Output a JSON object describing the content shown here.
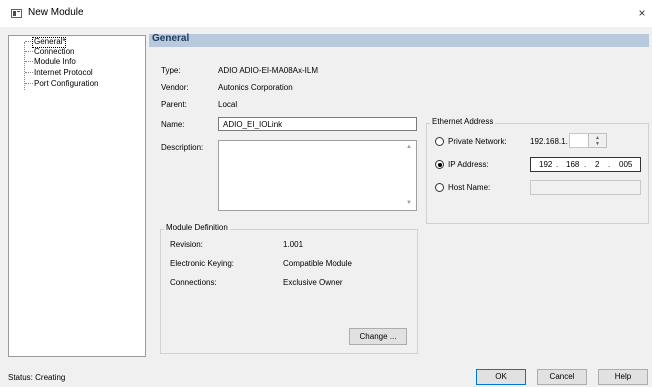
{
  "window": {
    "title": "New Module",
    "close_glyph": "×"
  },
  "tree": {
    "items": [
      {
        "label": "General*"
      },
      {
        "label": "Connection"
      },
      {
        "label": "Module Info"
      },
      {
        "label": "Internet Protocol"
      },
      {
        "label": "Port Configuration"
      }
    ]
  },
  "general": {
    "header": "General",
    "type_label": "Type:",
    "type_value": "ADIO ADIO-EI-MA08Ax-ILM",
    "vendor_label": "Vendor:",
    "vendor_value": "Autonics Corporation",
    "parent_label": "Parent:",
    "parent_value": "Local",
    "name_label": "Name:",
    "name_value": "ADIO_EI_IOLink",
    "description_label": "Description:",
    "description_value": ""
  },
  "ethernet": {
    "group_title": "Ethernet Address",
    "private_label": "Private Network:",
    "private_prefix": "192.168.1.",
    "private_value": "",
    "ip_label": "IP Address:",
    "ip_octets": [
      "192",
      "168",
      "2",
      "005"
    ],
    "ip_separator": ".",
    "host_label": "Host Name:",
    "host_value": "",
    "selected": "ip"
  },
  "module_definition": {
    "group_title": "Module Definition",
    "revision_label": "Revision:",
    "revision_value": "1.001",
    "keying_label": "Electronic Keying:",
    "keying_value": "Compatible Module",
    "connections_label": "Connections:",
    "connections_value": "Exclusive Owner",
    "change_button": "Change ..."
  },
  "footer": {
    "status": "Status:  Creating",
    "ok": "OK",
    "cancel": "Cancel",
    "help": "Help"
  },
  "icons": {
    "app": "module-window-icon",
    "close": "close-icon",
    "scroll_up": "chevron-up-icon",
    "scroll_down": "chevron-down-icon"
  }
}
